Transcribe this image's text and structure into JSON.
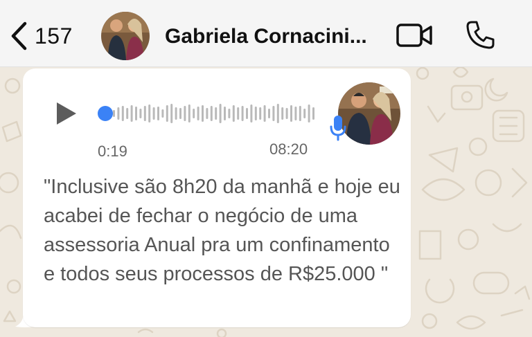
{
  "header": {
    "back_count": "157",
    "contact_name": "Gabriela Cornacini..."
  },
  "message": {
    "elapsed": "0:19",
    "duration": "08:20",
    "playback_progress": 0.0,
    "transcript": "\"Inclusive são 8h20 da manhã e hoje eu acabei de fechar o negócio de uma assessoria Anual pra um confinamento e todos seus processos de R$25.000 \""
  },
  "colors": {
    "accent_blue": "#3b82f6",
    "bubble": "#ffffff",
    "wallpaper": "#efe9df"
  },
  "icons": [
    "chevron-left-icon",
    "video-camera-icon",
    "phone-icon",
    "play-icon",
    "microphone-icon"
  ]
}
